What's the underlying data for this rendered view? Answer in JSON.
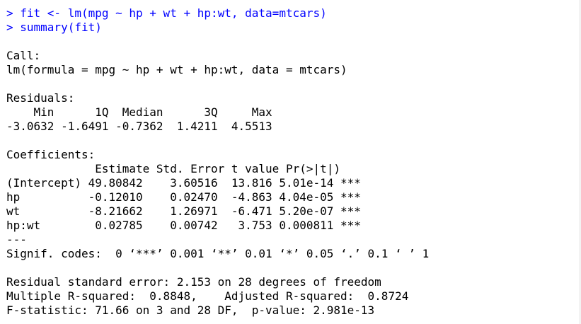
{
  "colors": {
    "background": "#ffffff",
    "command_text": "#0000ff",
    "output_text": "#000000"
  },
  "commands": [
    "> fit <- lm(mpg ~ hp + wt + hp:wt, data=mtcars)",
    "> summary(fit)"
  ],
  "call": {
    "header": "Call:",
    "formula": "lm(formula = mpg ~ hp + wt + hp:wt, data = mtcars)"
  },
  "residuals": {
    "header": "Residuals:",
    "labels_line": "    Min      1Q  Median      3Q     Max ",
    "values_line": "-3.0632 -1.6491 -0.7362  1.4211  4.5513 "
  },
  "coefficients": {
    "header": "Coefficients:",
    "header_line": "             Estimate Std. Error t value Pr(>|t|)    ",
    "rows": [
      "(Intercept) 49.80842    3.60516  13.816 5.01e-14 ***",
      "hp          -0.12010    0.02470  -4.863 4.04e-05 ***",
      "wt          -8.21662    1.26971  -6.471 5.20e-07 ***",
      "hp:wt        0.02785    0.00742   3.753 0.000811 ***"
    ],
    "separator": "---",
    "signif_codes": "Signif. codes:  0 ‘***’ 0.001 ‘**’ 0.01 ‘*’ 0.05 ‘.’ 0.1 ‘ ’ 1"
  },
  "summary_stats": {
    "residual_se": "Residual standard error: 2.153 on 28 degrees of freedom",
    "r_squared": "Multiple R-squared:  0.8848,\tAdjusted R-squared:  0.8724 ",
    "f_statistic": "F-statistic: 71.66 on 3 and 28 DF,  p-value: 2.981e-13"
  }
}
